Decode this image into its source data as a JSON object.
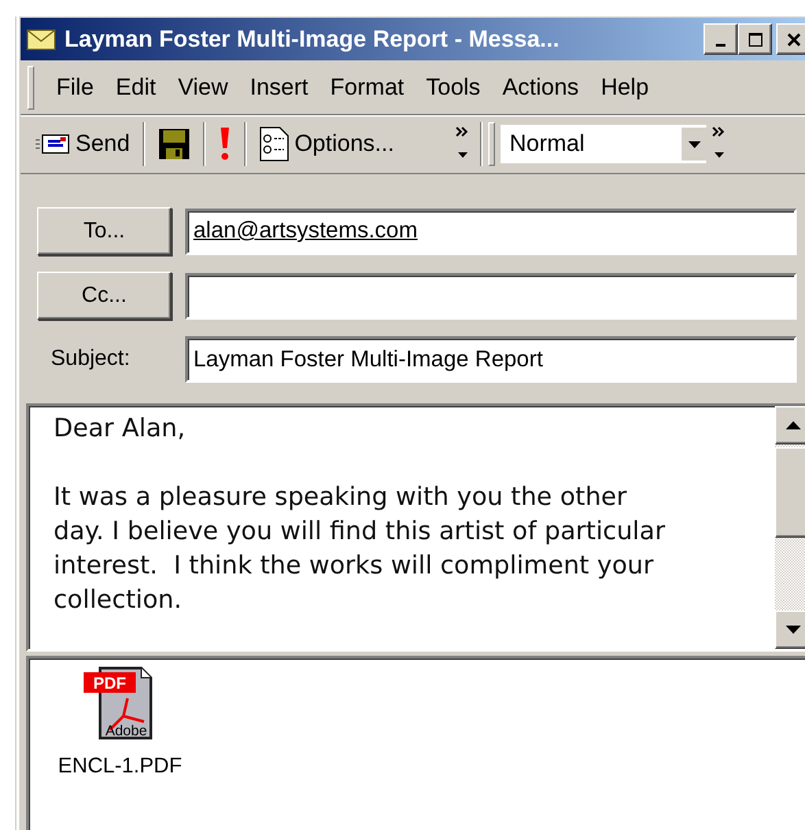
{
  "window": {
    "title": "Layman Foster Multi-Image Report - Messa..."
  },
  "menu": [
    {
      "label": "File"
    },
    {
      "label": "Edit"
    },
    {
      "label": "View"
    },
    {
      "label": "Insert"
    },
    {
      "label": "Format"
    },
    {
      "label": "Tools"
    },
    {
      "label": "Actions"
    },
    {
      "label": "Help"
    }
  ],
  "toolbar": [
    {
      "kind": "send",
      "label": "Send"
    },
    {
      "kind": "save"
    },
    {
      "kind": "importance"
    },
    {
      "kind": "options",
      "label": "Options..."
    },
    {
      "kind": "chevron"
    },
    {
      "kind": "style",
      "value": "Normal"
    },
    {
      "kind": "chevron"
    }
  ],
  "fields": [
    {
      "kind": "button",
      "label": "To...",
      "value": "alan@artsystems.com",
      "resolved": true
    },
    {
      "kind": "button",
      "label": "Cc..."
    },
    {
      "kind": "label",
      "label": "Subject:",
      "value": "Layman Foster Multi-Image Report",
      "resolved": false
    }
  ],
  "body": {
    "paragraphs": [
      "Dear Alan,",
      "It was a pleasure speaking with you the other day. I believe you will find this artist of particular interest.  I think the works will compliment your collection."
    ]
  },
  "attachments": [
    {
      "name": "ENCL-1.PDF",
      "badge": "PDF",
      "brand": "Adobe"
    }
  ]
}
